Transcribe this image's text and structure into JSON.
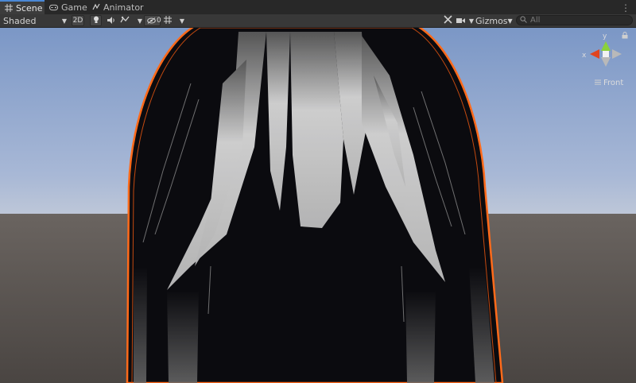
{
  "tabs": [
    {
      "label": "Scene",
      "icon": "grid-icon",
      "active": true
    },
    {
      "label": "Game",
      "icon": "gamepad-icon",
      "active": false
    },
    {
      "label": "Animator",
      "icon": "animator-icon",
      "active": false
    }
  ],
  "toolbar": {
    "shading_mode": "Shaded",
    "mode_2d": "2D",
    "hidden_count": "0",
    "gizmos_label": "Gizmos",
    "search_placeholder": "All"
  },
  "gizmo": {
    "axis_y": "y",
    "axis_x": "x",
    "view_label": "Front"
  },
  "colors": {
    "sky": "#8aa3cf",
    "ground": "#4a4542",
    "hair_dark": "#0b0b0f",
    "outline": "#ff6a1a",
    "accent_tab": "#4a88d6"
  }
}
